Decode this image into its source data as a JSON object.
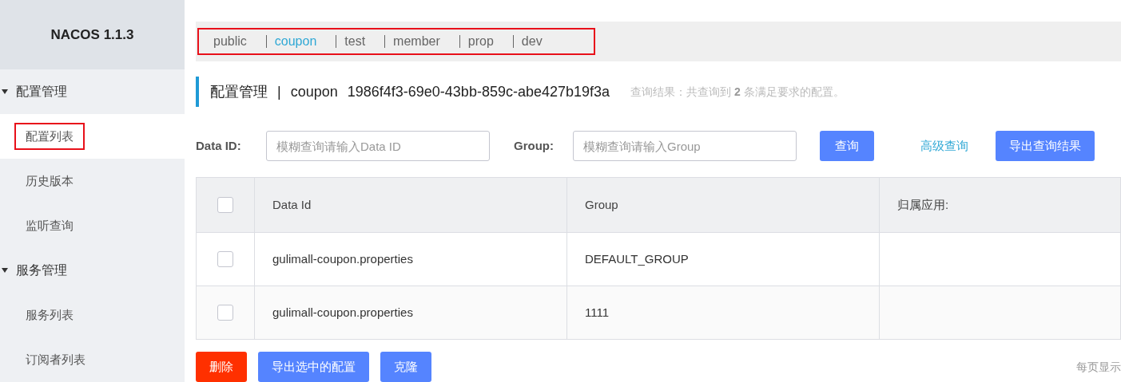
{
  "sidebar": {
    "title": "NACOS 1.1.3",
    "groups": [
      {
        "label": "配置管理",
        "expanded": true,
        "items": [
          {
            "label": "配置列表",
            "selected": true,
            "highlighted": true
          },
          {
            "label": "历史版本",
            "selected": false,
            "highlighted": false
          },
          {
            "label": "监听查询",
            "selected": false,
            "highlighted": false
          }
        ]
      },
      {
        "label": "服务管理",
        "expanded": true,
        "items": [
          {
            "label": "服务列表",
            "selected": false,
            "highlighted": false
          },
          {
            "label": "订阅者列表",
            "selected": false,
            "highlighted": false
          }
        ]
      }
    ]
  },
  "namespaces": {
    "highlighted": true,
    "items": [
      {
        "label": "public",
        "selected": false
      },
      {
        "label": "coupon",
        "selected": true
      },
      {
        "label": "test",
        "selected": false
      },
      {
        "label": "member",
        "selected": false
      },
      {
        "label": "prop",
        "selected": false
      },
      {
        "label": "dev",
        "selected": false
      }
    ]
  },
  "header": {
    "title": "配置管理",
    "separator": "|",
    "namespace": "coupon",
    "namespace_id": "1986f4f3-69e0-43bb-859c-abe427b19f3a",
    "result": "查询结果：共查询到 **2** 条满足要求的配置。"
  },
  "search": {
    "data_id_label": "Data ID:",
    "data_id_placeholder": "模糊查询请输入Data ID",
    "group_label": "Group:",
    "group_placeholder": "模糊查询请输入Group",
    "query_button": "查询",
    "advanced_link": "高级查询",
    "export_button": "导出查询结果"
  },
  "table": {
    "columns": [
      "Data Id",
      "Group",
      "归属应用:"
    ],
    "all_checked": false,
    "rows": [
      {
        "checked": false,
        "cells": [
          "gulimall-coupon.properties",
          "DEFAULT_GROUP",
          ""
        ]
      },
      {
        "checked": false,
        "cells": [
          "gulimall-coupon.properties",
          "1111",
          ""
        ]
      }
    ]
  },
  "actions": [
    {
      "label": "删除",
      "kind": "danger"
    },
    {
      "label": "导出选中的配置",
      "kind": "primary"
    },
    {
      "label": "克隆",
      "kind": "primary"
    }
  ],
  "pagination": {
    "page_size_label": "每页显示"
  }
}
